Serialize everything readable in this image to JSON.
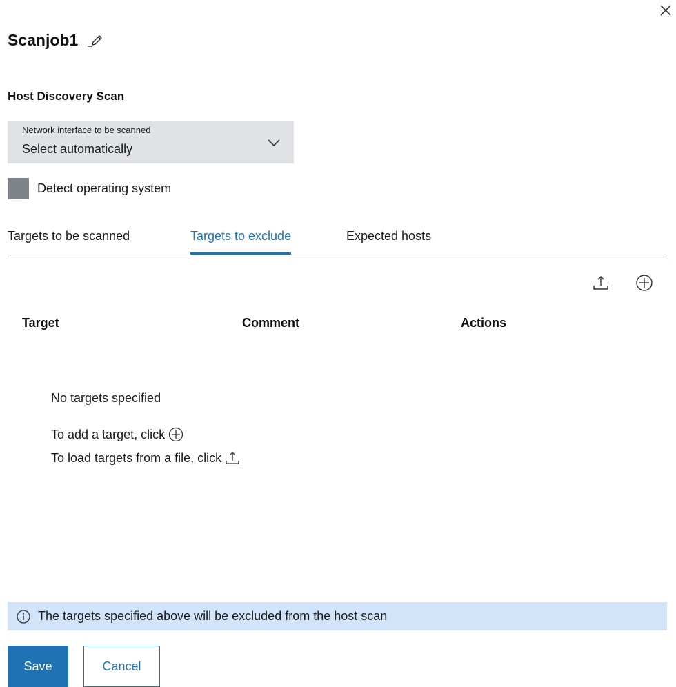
{
  "dialog": {
    "title": "Scanjob1",
    "close_icon": "close-icon",
    "edit_icon": "pencil-icon"
  },
  "host_discovery": {
    "section_title": "Host Discovery Scan",
    "network_interface": {
      "label": "Network interface to be scanned",
      "value": "Select automatically",
      "icon": "chevron-down-icon"
    },
    "detect_os": {
      "label": "Detect operating system",
      "checked": false
    }
  },
  "tabs": [
    {
      "label": "Targets to be scanned",
      "active": false
    },
    {
      "label": "Targets to exclude",
      "active": true
    },
    {
      "label": "Expected hosts",
      "active": false
    }
  ],
  "toolbar": {
    "upload_icon": "upload-icon",
    "add_icon": "add-circle-icon"
  },
  "table": {
    "columns": [
      "Target",
      "Comment",
      "Actions"
    ],
    "rows": []
  },
  "empty_state": {
    "title": "No targets specified",
    "add_hint": "To add a target, click",
    "load_hint": "To load targets from a file, click"
  },
  "notice": {
    "icon": "info-icon",
    "text": "The targets specified above will be excluded from the host scan"
  },
  "buttons": {
    "save": "Save",
    "cancel": "Cancel"
  },
  "colors": {
    "accent": "#1f73b5",
    "notice_bg": "#d1e4fa",
    "select_bg": "#e0e2e5",
    "checkbox": "#7d8389"
  }
}
